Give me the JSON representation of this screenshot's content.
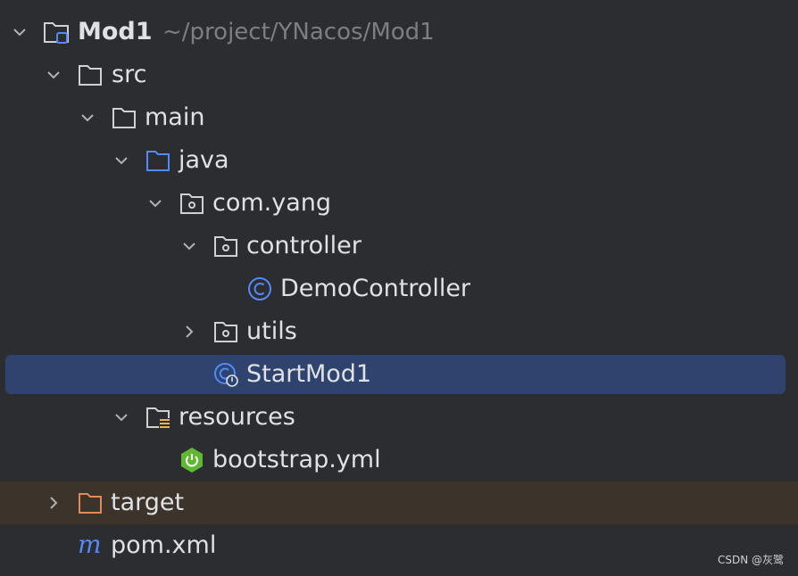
{
  "colors": {
    "background": "#2b2d30",
    "text": "#dfe1e5",
    "path_text": "#7a7e85",
    "selection": "#2e436e",
    "excluded_row": "#3c342a",
    "chevron": "#afb1b3",
    "folder": "#ced0d6",
    "source_folder": "#548af7",
    "excluded_folder": "#e08a5a",
    "class_icon": "#548af7",
    "spring_icon": "#5fb832",
    "resources_marker": "#e8b647"
  },
  "tree": {
    "root": {
      "label": "Mod1",
      "path": "~/project/YNacos/Mod1",
      "icon": "module-folder-icon",
      "expanded": true
    },
    "src": {
      "label": "src",
      "icon": "folder-icon",
      "expanded": true
    },
    "main": {
      "label": "main",
      "icon": "folder-icon",
      "expanded": true
    },
    "java": {
      "label": "java",
      "icon": "source-root-folder-icon",
      "expanded": true
    },
    "com_yang": {
      "label": "com.yang",
      "icon": "package-icon",
      "expanded": true
    },
    "controller": {
      "label": "controller",
      "icon": "package-icon",
      "expanded": true
    },
    "demo_controller": {
      "label": "DemoController",
      "icon": "class-icon"
    },
    "utils": {
      "label": "utils",
      "icon": "package-icon",
      "expanded": false
    },
    "start_mod1": {
      "label": "StartMod1",
      "icon": "spring-boot-class-icon",
      "selected": true
    },
    "resources": {
      "label": "resources",
      "icon": "resources-root-folder-icon",
      "expanded": true
    },
    "bootstrap": {
      "label": "bootstrap.yml",
      "icon": "spring-config-icon"
    },
    "target": {
      "label": "target",
      "icon": "excluded-folder-icon",
      "expanded": false
    },
    "pom": {
      "label": "pom.xml",
      "icon": "maven-icon"
    }
  },
  "watermark": "CSDN @灰鹭"
}
